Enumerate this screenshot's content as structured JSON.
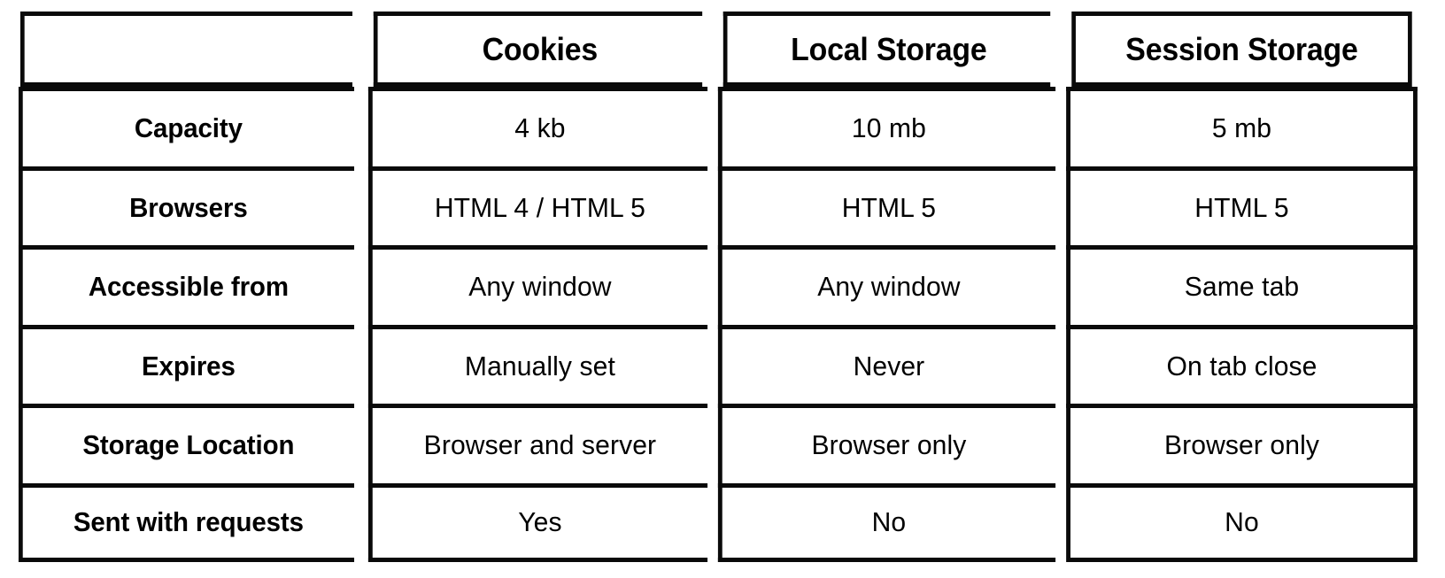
{
  "page": {
    "background_color": "#ffffff",
    "text_color": "#000000",
    "border_color": "#0a0a0a"
  },
  "table": {
    "corner_label": "",
    "column_headers": [
      "Cookies",
      "Local Storage",
      "Session Storage"
    ],
    "row_labels": [
      "Capacity",
      "Browsers",
      "Accessible from",
      "Expires",
      "Storage Location",
      "Sent with requests"
    ],
    "rows": [
      {
        "label": "Capacity",
        "cookies": "4 kb",
        "local_storage": "10 mb",
        "session_storage": "5 mb"
      },
      {
        "label": "Browsers",
        "cookies": "HTML 4 / HTML 5",
        "local_storage": "HTML 5",
        "session_storage": "HTML 5"
      },
      {
        "label": "Accessible from",
        "cookies": "Any window",
        "local_storage": "Any window",
        "session_storage": "Same tab"
      },
      {
        "label": "Expires",
        "cookies": "Manually set",
        "local_storage": "Never",
        "session_storage": "On tab close"
      },
      {
        "label": "Storage Location",
        "cookies": "Browser and server",
        "local_storage": "Browser only",
        "session_storage": "Browser only"
      },
      {
        "label": "Sent with requests",
        "cookies": "Yes",
        "local_storage": "No",
        "session_storage": "No"
      }
    ]
  }
}
